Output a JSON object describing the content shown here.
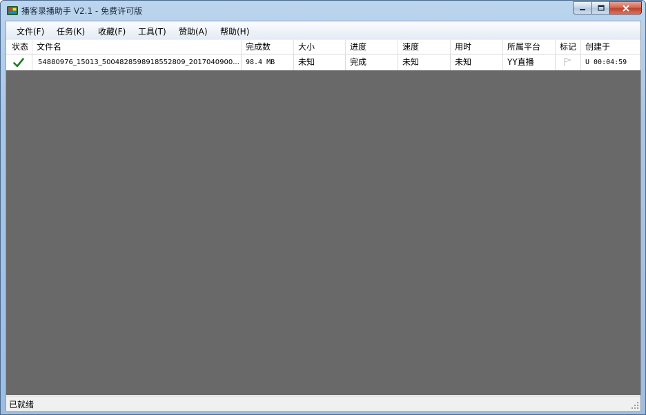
{
  "window": {
    "title": "播客录播助手 V2.1 - 免费许可版"
  },
  "menu": [
    {
      "label": "文件(F)"
    },
    {
      "label": "任务(K)"
    },
    {
      "label": "收藏(F)"
    },
    {
      "label": "工具(T)"
    },
    {
      "label": "赞助(A)"
    },
    {
      "label": "帮助(H)"
    }
  ],
  "table": {
    "columns": [
      "状态",
      "文件名",
      "完成数",
      "大小",
      "进度",
      "速度",
      "用时",
      "所属平台",
      "标记",
      "创建于"
    ],
    "rows": [
      {
        "status_icon": "check-icon",
        "filename": "54880976_15013_5004828598918552809_2017040900...",
        "completed": "98.4 MB",
        "size": "未知",
        "progress": "完成",
        "speed": "未知",
        "elapsed": "未知",
        "platform": "YY直播",
        "mark_icon": "flag-icon",
        "created": "U 00:04:59"
      }
    ]
  },
  "status": {
    "text": "已就绪"
  },
  "colors": {
    "list_background": "#696969",
    "check": "#1e7a1e",
    "close_button": "#c7432b"
  }
}
